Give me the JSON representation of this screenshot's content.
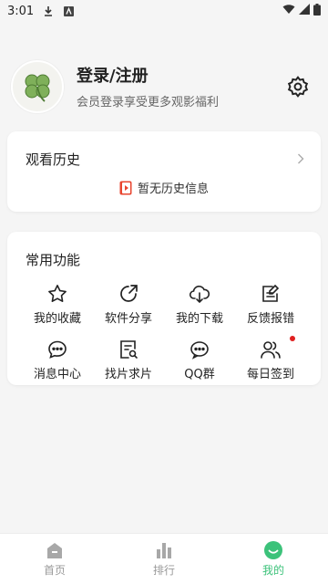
{
  "status_bar": {
    "time": "3:01"
  },
  "profile": {
    "title": "登录/注册",
    "subtitle": "会员登录享受更多观影福利"
  },
  "history": {
    "title": "观看历史",
    "empty_text": "暂无历史信息"
  },
  "features": {
    "title": "常用功能",
    "items": [
      {
        "label": "我的收藏",
        "icon": "star-icon"
      },
      {
        "label": "软件分享",
        "icon": "share-icon"
      },
      {
        "label": "我的下载",
        "icon": "cloud-download-icon"
      },
      {
        "label": "反馈报错",
        "icon": "feedback-icon"
      },
      {
        "label": "消息中心",
        "icon": "message-icon"
      },
      {
        "label": "找片求片",
        "icon": "search-doc-icon"
      },
      {
        "label": "QQ群",
        "icon": "chat-icon"
      },
      {
        "label": "每日签到",
        "icon": "users-icon",
        "badge": true
      }
    ]
  },
  "tabbar": {
    "tabs": [
      {
        "label": "首页",
        "active": false
      },
      {
        "label": "排行",
        "active": false
      },
      {
        "label": "我的",
        "active": true
      }
    ]
  },
  "colors": {
    "accent": "#3cc27a",
    "badge": "#e02020"
  }
}
